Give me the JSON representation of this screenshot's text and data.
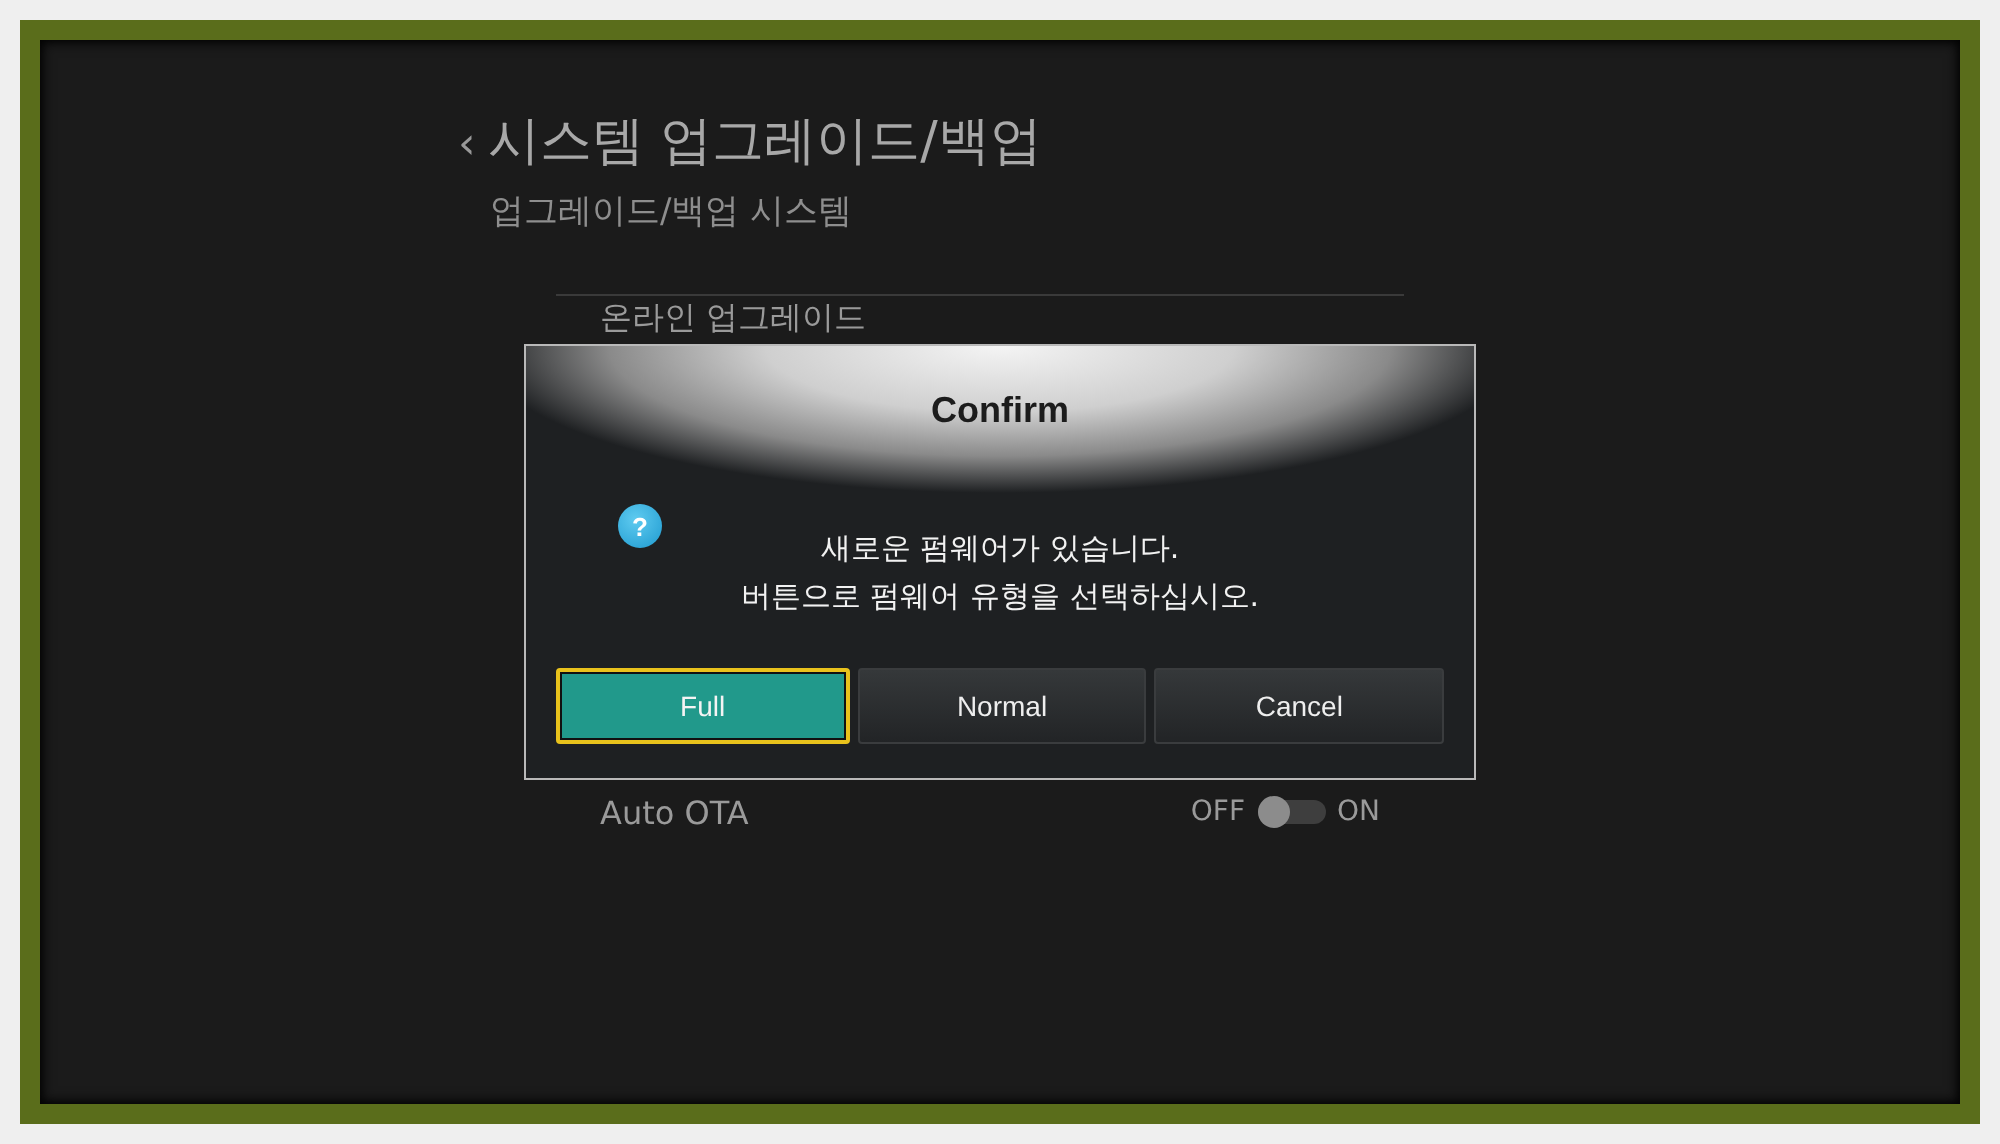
{
  "header": {
    "back": "‹",
    "title": "시스템 업그레이드/백업",
    "subtitle": "업그레이드/백업 시스템"
  },
  "menu": [
    {
      "kind": "link",
      "label": "온라인 업그레이드"
    },
    {
      "kind": "toggle",
      "label": "Auto OTA",
      "off_label": "OFF",
      "on_label": "ON",
      "on": false
    }
  ],
  "dialog": {
    "title": "Confirm",
    "icon_glyph": "?",
    "message": [
      "새로운 펌웨어가 있습니다.",
      "버튼으로 펌웨어 유형을 선택하십시오."
    ],
    "buttons": [
      {
        "label": "Full",
        "selected": true
      },
      {
        "label": "Normal",
        "selected": false
      },
      {
        "label": "Cancel",
        "selected": false
      }
    ]
  }
}
